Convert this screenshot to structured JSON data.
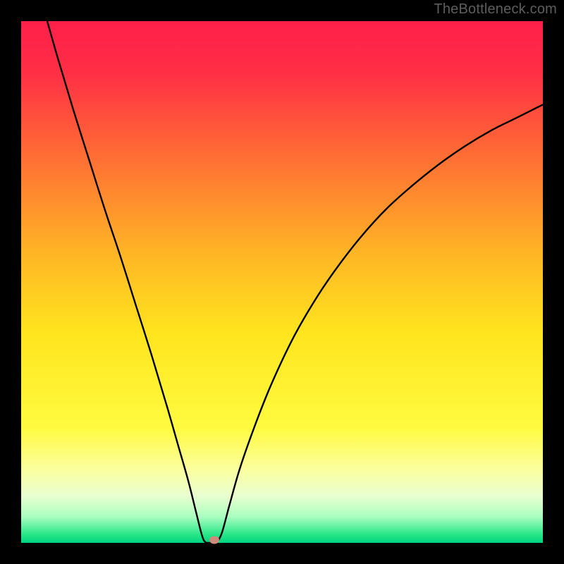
{
  "watermark": "TheBottleneck.com",
  "chart_data": {
    "type": "line",
    "title": "",
    "xlabel": "",
    "ylabel": "",
    "xlim": [
      0,
      100
    ],
    "ylim": [
      0,
      100
    ],
    "background_gradient": {
      "stops": [
        {
          "offset": 0.0,
          "color": "#ff1f4a"
        },
        {
          "offset": 0.1,
          "color": "#ff2f45"
        },
        {
          "offset": 0.25,
          "color": "#ff6a35"
        },
        {
          "offset": 0.45,
          "color": "#ffb725"
        },
        {
          "offset": 0.6,
          "color": "#ffe51e"
        },
        {
          "offset": 0.78,
          "color": "#fffb40"
        },
        {
          "offset": 0.86,
          "color": "#fbffa0"
        },
        {
          "offset": 0.91,
          "color": "#eaffd0"
        },
        {
          "offset": 0.95,
          "color": "#aaffc0"
        },
        {
          "offset": 0.985,
          "color": "#25e587"
        },
        {
          "offset": 1.0,
          "color": "#00d480"
        }
      ]
    },
    "notch_x": 35.5,
    "marker": {
      "x": 37,
      "y": 0.5,
      "color": "#d08a7a"
    },
    "series": [
      {
        "name": "curve",
        "points": [
          {
            "x": 5.0,
            "y": 100.0
          },
          {
            "x": 7.0,
            "y": 93.0
          },
          {
            "x": 10.0,
            "y": 83.0
          },
          {
            "x": 13.0,
            "y": 73.5
          },
          {
            "x": 16.0,
            "y": 64.0
          },
          {
            "x": 19.0,
            "y": 55.0
          },
          {
            "x": 22.0,
            "y": 45.5
          },
          {
            "x": 25.0,
            "y": 36.0
          },
          {
            "x": 28.0,
            "y": 26.0
          },
          {
            "x": 30.0,
            "y": 19.0
          },
          {
            "x": 32.0,
            "y": 12.0
          },
          {
            "x": 33.5,
            "y": 6.0
          },
          {
            "x": 34.5,
            "y": 2.0
          },
          {
            "x": 35.0,
            "y": 0.5
          },
          {
            "x": 35.5,
            "y": 0.0
          },
          {
            "x": 37.5,
            "y": 0.0
          },
          {
            "x": 38.5,
            "y": 2.0
          },
          {
            "x": 40.0,
            "y": 7.5
          },
          {
            "x": 42.0,
            "y": 14.5
          },
          {
            "x": 45.0,
            "y": 23.0
          },
          {
            "x": 48.0,
            "y": 30.5
          },
          {
            "x": 52.0,
            "y": 39.0
          },
          {
            "x": 56.0,
            "y": 46.0
          },
          {
            "x": 60.0,
            "y": 52.0
          },
          {
            "x": 65.0,
            "y": 58.5
          },
          {
            "x": 70.0,
            "y": 64.0
          },
          {
            "x": 75.0,
            "y": 68.5
          },
          {
            "x": 80.0,
            "y": 72.5
          },
          {
            "x": 85.0,
            "y": 76.0
          },
          {
            "x": 90.0,
            "y": 79.0
          },
          {
            "x": 95.0,
            "y": 81.5
          },
          {
            "x": 100.0,
            "y": 84.0
          }
        ]
      }
    ]
  }
}
